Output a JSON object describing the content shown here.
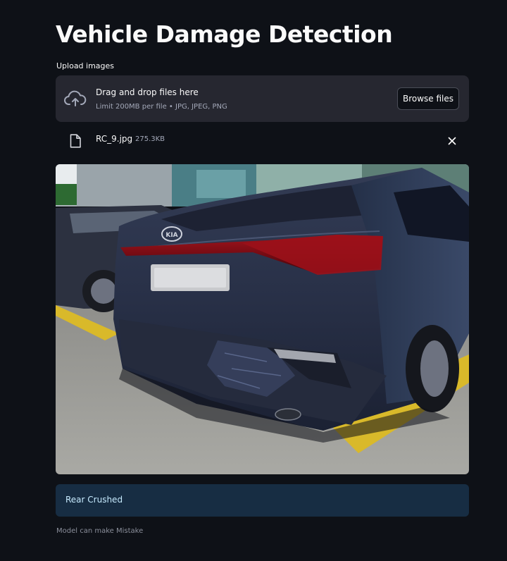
{
  "title": "Vehicle Damage Detection",
  "uploader": {
    "label": "Upload images",
    "dropzone_title": "Drag and drop files here",
    "dropzone_subtitle": "Limit 200MB per file • JPG, JPEG, PNG",
    "browse_label": "Browse files",
    "icon": "cloud-upload-icon"
  },
  "file": {
    "name": "RC_9.jpg",
    "size": "275.3KB",
    "icon": "file-icon",
    "remove_icon": "close-icon"
  },
  "image": {
    "subject": "car-photo",
    "plate_text": "",
    "brand_text": "KIA"
  },
  "result": {
    "label": "Rear Crushed"
  },
  "caption": "Model can make Mistake",
  "colors": {
    "background": "#0e1117",
    "panel": "#262730",
    "result_bg": "#172d43",
    "result_text": "#c7ebff"
  }
}
